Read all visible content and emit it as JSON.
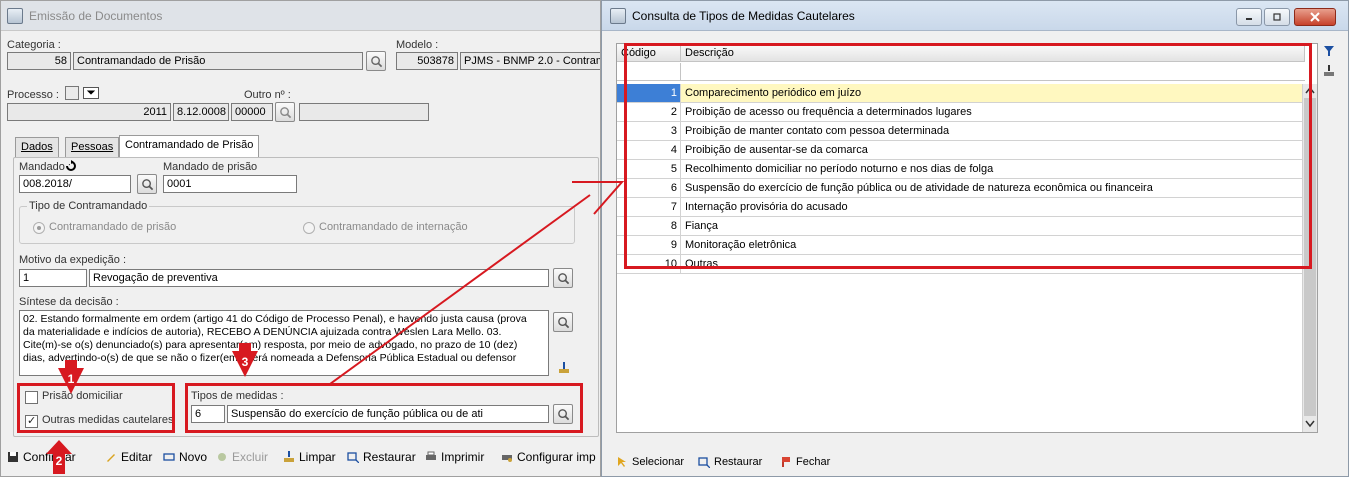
{
  "left_window": {
    "title": "Emissão de Documentos",
    "categoria": {
      "label": "Categoria :",
      "code": "58",
      "name": "Contramandado de Prisão"
    },
    "modelo": {
      "label": "Modelo :",
      "code": "503878",
      "name": "PJMS - BNMP 2.0 - Contram"
    },
    "processo": {
      "label": "Processo :",
      "ano": "2011",
      "numero": "8.12.0008",
      "seq": "00000"
    },
    "outro": {
      "label": "Outro nº :",
      "value": ""
    },
    "tabs": [
      {
        "label": "Dados"
      },
      {
        "label": "Pessoas"
      },
      {
        "label": "Contramandado de Prisão"
      }
    ],
    "mandado": {
      "label": "Mandado :",
      "value": "008.2018/"
    },
    "mandado_prisao": {
      "label": "Mandado de prisão",
      "value": "0001"
    },
    "tipo_contramandado": {
      "legend": "Tipo de Contramandado",
      "options": [
        {
          "label": "Contramandado de prisão",
          "selected": true
        },
        {
          "label": "Contramandado de internação",
          "selected": false
        }
      ]
    },
    "motivo": {
      "label": "Motivo da expedição :",
      "code": "1",
      "text": "Revogação de preventiva"
    },
    "sintese": {
      "label": "Síntese da decisão :",
      "lines": [
        "02. Estando formalmente em ordem (artigo 41 do Código de Processo Penal), e havendo justa causa (prova",
        "da materialidade e indícios de autoria), RECEBO A DENÚNCIA ajuizada contra Weslen Lara Mello. 03.",
        "Cite(m)-se o(s) denunciado(s) para apresentar(em) resposta, por meio de advogado, no prazo de 10 (dez)",
        "dias, advertindo-o(s) de que se não o fizer(em), será nomeada a Defensoria Pública Estadual ou defensor"
      ]
    },
    "prisao_domiciliar": {
      "label": "Prisão domiciliar",
      "checked": false
    },
    "outras_medidas": {
      "label": "Outras medidas cautelares",
      "checked": true
    },
    "tipos_medidas": {
      "label": "Tipos de medidas :",
      "code": "6",
      "text": "Suspensão do exercício de função pública ou de ati"
    },
    "toolbar": [
      {
        "label": "Confirmar",
        "icon": "save-icon",
        "disabled": false
      },
      {
        "label": "Editar",
        "icon": "pencil-icon",
        "disabled": false
      },
      {
        "label": "Novo",
        "icon": "new-icon",
        "disabled": false
      },
      {
        "label": "Excluir",
        "icon": "delete-icon",
        "disabled": true
      },
      {
        "label": "Limpar",
        "icon": "broom-icon",
        "disabled": false
      },
      {
        "label": "Restaurar",
        "icon": "restore-icon",
        "disabled": false
      },
      {
        "label": "Imprimir",
        "icon": "print-icon",
        "disabled": false
      },
      {
        "label": "Configurar imp",
        "icon": "printer-settings-icon",
        "disabled": false
      }
    ]
  },
  "right_window": {
    "title": "Consulta de Tipos de Medidas Cautelares",
    "columns": [
      "Código",
      "Descrição"
    ],
    "rows": [
      {
        "code": "1",
        "desc": "Comparecimento periódico em juízo",
        "selected": true
      },
      {
        "code": "2",
        "desc": "Proibição de acesso ou frequência a determinados lugares"
      },
      {
        "code": "3",
        "desc": "Proibição de manter contato com pessoa determinada"
      },
      {
        "code": "4",
        "desc": "Proibição de ausentar-se da comarca"
      },
      {
        "code": "5",
        "desc": "Recolhimento domiciliar no período noturno e nos dias de folga"
      },
      {
        "code": "6",
        "desc": "Suspensão do exercício de função pública ou de atividade de natureza econômica ou financeira"
      },
      {
        "code": "7",
        "desc": "Internação provisória do acusado"
      },
      {
        "code": "8",
        "desc": "Fiança"
      },
      {
        "code": "9",
        "desc": "Monitoração eletrônica"
      },
      {
        "code": "10",
        "desc": "Outras"
      }
    ],
    "footer": [
      {
        "label": "Selecionar",
        "icon": "select-pointer-icon"
      },
      {
        "label": "Restaurar",
        "icon": "restore-icon"
      },
      {
        "label": "Fechar",
        "icon": "close-flag-icon"
      }
    ]
  },
  "annotations": {
    "markers": [
      "1",
      "2",
      "3"
    ],
    "color": "#d71920"
  }
}
